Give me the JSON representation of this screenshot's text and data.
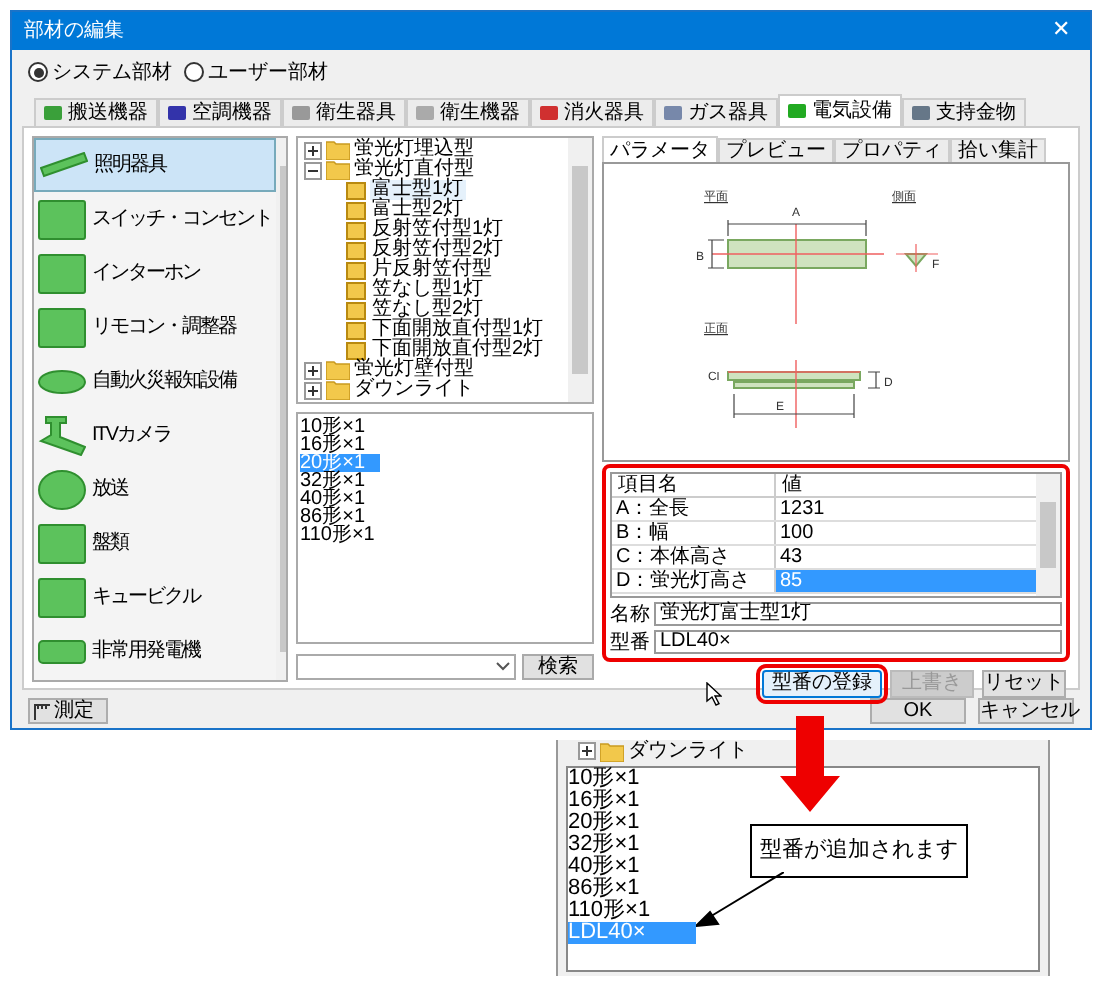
{
  "window": {
    "title": "部材の編集",
    "close": "✕"
  },
  "source_options": [
    {
      "label": "システム部材",
      "selected": true
    },
    {
      "label": "ユーザー部材",
      "selected": false
    }
  ],
  "tabs": [
    {
      "label": "搬送機器",
      "selected": false,
      "color": "#3aa03a"
    },
    {
      "label": "空調機器",
      "selected": false,
      "color": "#3333aa"
    },
    {
      "label": "衛生器具",
      "selected": false,
      "color": "#999999"
    },
    {
      "label": "衛生機器",
      "selected": false,
      "color": "#aaaaaa"
    },
    {
      "label": "消火器具",
      "selected": false,
      "color": "#d03030"
    },
    {
      "label": "ガス器具",
      "selected": false,
      "color": "#7788aa"
    },
    {
      "label": "電気設備",
      "selected": true,
      "color": "#22aa22"
    },
    {
      "label": "支持金物",
      "selected": false,
      "color": "#667788"
    }
  ],
  "categories": [
    {
      "label": "照明器具",
      "selected": true
    },
    {
      "label": "スイッチ・コンセント",
      "selected": false
    },
    {
      "label": "インターホン",
      "selected": false
    },
    {
      "label": "リモコン・調整器",
      "selected": false
    },
    {
      "label": "自動火災報知設備",
      "selected": false
    },
    {
      "label": "ITVカメラ",
      "selected": false
    },
    {
      "label": "放送",
      "selected": false
    },
    {
      "label": "盤類",
      "selected": false
    },
    {
      "label": "キュービクル",
      "selected": false
    },
    {
      "label": "非常用発電機",
      "selected": false
    }
  ],
  "tree": [
    {
      "label": "蛍光灯埋込型",
      "expanded": false
    },
    {
      "label": "蛍光灯直付型",
      "expanded": true,
      "children": [
        {
          "label": "富士型1灯",
          "selected": true
        },
        {
          "label": "富士型2灯",
          "selected": false
        },
        {
          "label": "反射笠付型1灯",
          "selected": false
        },
        {
          "label": "反射笠付型2灯",
          "selected": false
        },
        {
          "label": "片反射笠付型",
          "selected": false
        },
        {
          "label": "笠なし型1灯",
          "selected": false
        },
        {
          "label": "笠なし型2灯",
          "selected": false
        },
        {
          "label": "下面開放直付型1灯",
          "selected": false
        },
        {
          "label": "下面開放直付型2灯",
          "selected": false
        }
      ]
    },
    {
      "label": "蛍光灯壁付型",
      "expanded": false
    },
    {
      "label": "ダウンライト",
      "expanded": false
    }
  ],
  "type_list": [
    {
      "label": "10形×1",
      "selected": false
    },
    {
      "label": "16形×1",
      "selected": false
    },
    {
      "label": "20形×1",
      "selected": true
    },
    {
      "label": "32形×1",
      "selected": false
    },
    {
      "label": "40形×1",
      "selected": false
    },
    {
      "label": "86形×1",
      "selected": false
    },
    {
      "label": "110形×1",
      "selected": false
    }
  ],
  "search": {
    "button": "検索"
  },
  "panel_tabs": [
    {
      "label": "パラメータ",
      "selected": true
    },
    {
      "label": "プレビュー",
      "selected": false
    },
    {
      "label": "プロパティ",
      "selected": false
    },
    {
      "label": "拾い集計",
      "selected": false
    }
  ],
  "drawing": {
    "views": [
      "平面",
      "側面",
      "正面"
    ],
    "dims": [
      "A",
      "B",
      "F",
      "C",
      "D",
      "E"
    ]
  },
  "table": {
    "columns": [
      "項目名",
      "値"
    ],
    "rows": [
      {
        "name": "A：全長",
        "value": "1231",
        "selected": false
      },
      {
        "name": "B：幅",
        "value": "100",
        "selected": false
      },
      {
        "name": "C：本体高さ",
        "value": "43",
        "selected": false
      },
      {
        "name": "D：蛍光灯高さ",
        "value": "85",
        "selected": true
      }
    ]
  },
  "name_field": {
    "label": "名称",
    "value": "蛍光灯富士型1灯"
  },
  "model_field": {
    "label": "型番",
    "value": "LDL40×"
  },
  "panel_buttons": [
    {
      "label": "型番の登録",
      "disabled": false,
      "highlighted": true
    },
    {
      "label": "上書き",
      "disabled": true,
      "highlighted": false
    },
    {
      "label": "リセット",
      "disabled": false,
      "highlighted": false
    }
  ],
  "measure_button": "測定",
  "dialog_buttons": [
    "OK",
    "キャンセル"
  ],
  "inset": {
    "tree_item": "ダウンライト",
    "list": [
      {
        "label": "10形×1",
        "selected": false
      },
      {
        "label": "16形×1",
        "selected": false
      },
      {
        "label": "20形×1",
        "selected": false
      },
      {
        "label": "32形×1",
        "selected": false
      },
      {
        "label": "40形×1",
        "selected": false
      },
      {
        "label": "86形×1",
        "selected": false
      },
      {
        "label": "110形×1",
        "selected": false
      },
      {
        "label": "LDL40×",
        "selected": true
      }
    ],
    "callout": "型番が追加されます"
  }
}
